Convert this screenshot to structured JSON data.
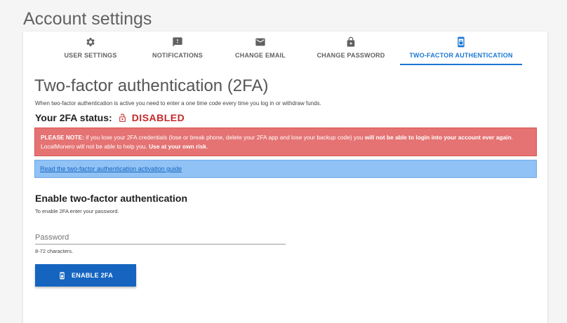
{
  "page": {
    "title": "Account settings"
  },
  "tabs": [
    {
      "label": "USER SETTINGS",
      "icon": "gear-icon"
    },
    {
      "label": "NOTIFICATIONS",
      "icon": "notification-icon"
    },
    {
      "label": "CHANGE EMAIL",
      "icon": "email-icon"
    },
    {
      "label": "CHANGE PASSWORD",
      "icon": "lock-icon"
    },
    {
      "label": "TWO-FACTOR AUTHENTICATION",
      "icon": "phone-lock-icon",
      "active": true
    }
  ],
  "twofa": {
    "heading": "Two-factor authentication (2FA)",
    "intro": "When two-factor authentication is active you need to enter a one time code every time you log in or withdraw funds.",
    "status_label": "Your 2FA status:",
    "status_value": "DISABLED",
    "status_color": "#c62828",
    "alert": {
      "prefix": "PLEASE NOTE:",
      "text1": " if you lose your 2FA credentials (lose or break phone, delete your 2FA app and lose your backup code) you ",
      "bold1": "will not be able to login into your account ever again",
      "text2": ". LocalMonero will not be able to help you. ",
      "bold2": "Use at your own risk",
      "text3": "."
    },
    "guide_link": "Read the two-factor authentication activation guide",
    "enable_heading": "Enable two-factor authentication",
    "enable_hint": "To enable 2FA enter your password.",
    "password_placeholder": "Password",
    "password_value": "",
    "password_hint": "8-72 characters.",
    "enable_button": "ENABLE 2FA"
  },
  "colors": {
    "accent": "#1976d2",
    "button": "#1565c0",
    "alert_red": "#e57373",
    "alert_blue": "#90c2f5"
  }
}
